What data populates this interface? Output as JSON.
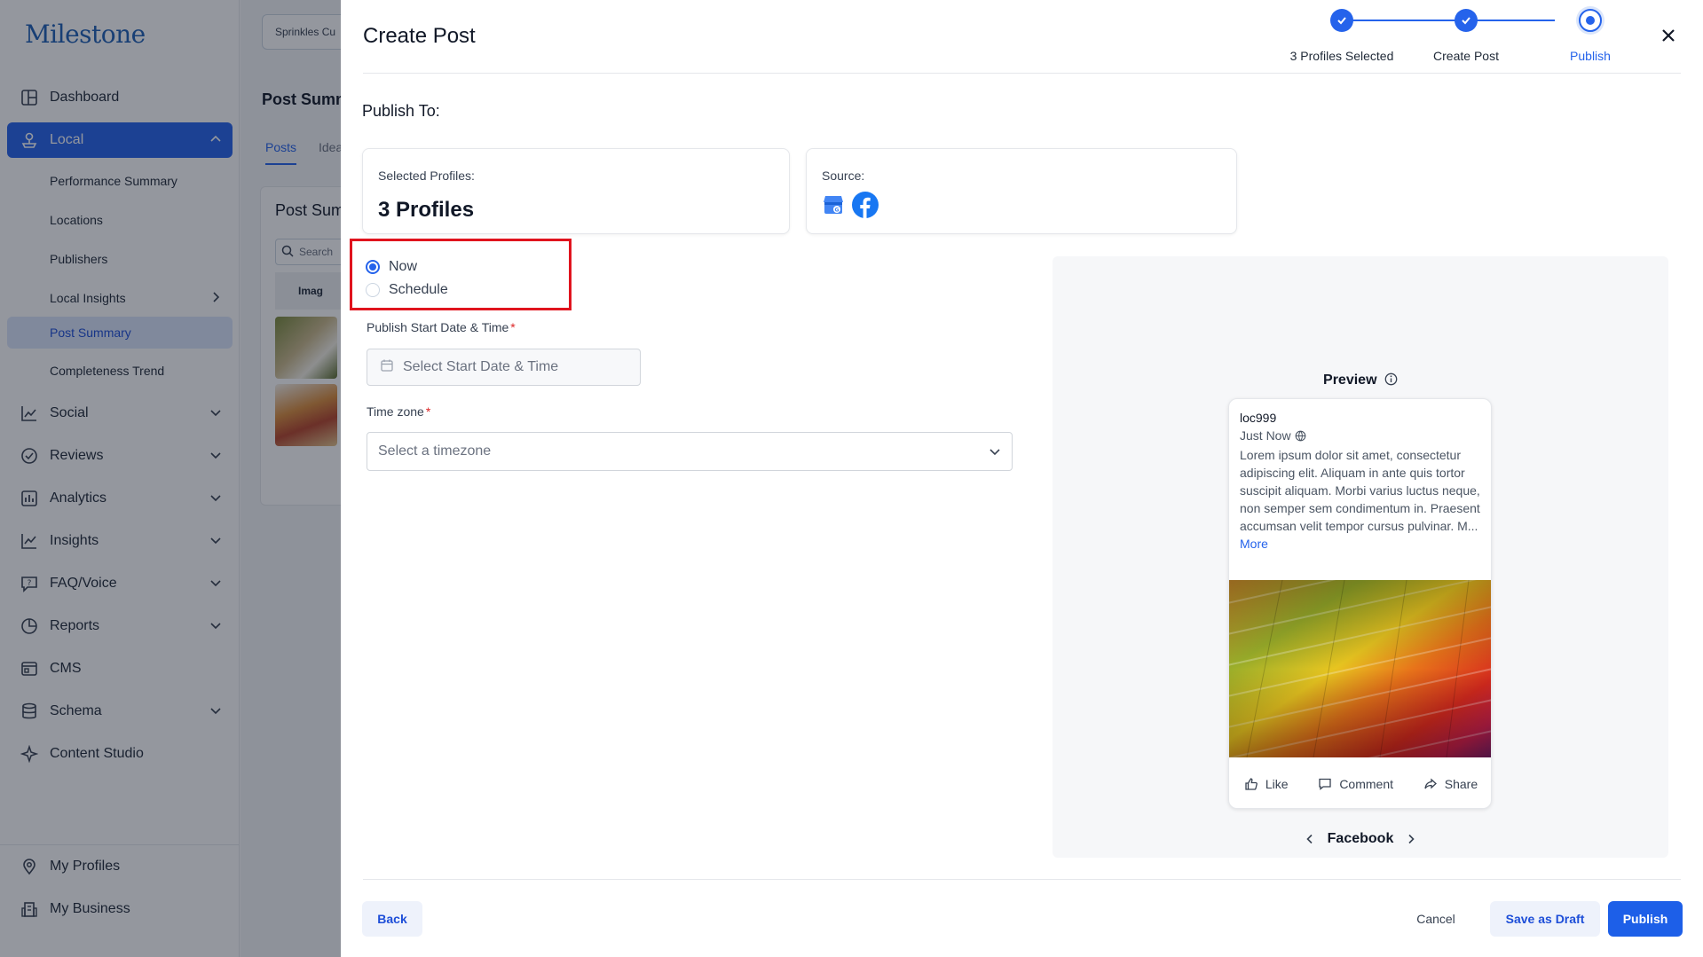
{
  "sidebar": {
    "logo": "Milestone",
    "items": [
      {
        "label": "Dashboard",
        "icon": "dashboard-icon"
      },
      {
        "label": "Local",
        "icon": "local-icon"
      },
      {
        "label": "Social",
        "icon": "social-icon"
      },
      {
        "label": "Reviews",
        "icon": "reviews-icon"
      },
      {
        "label": "Analytics",
        "icon": "analytics-icon"
      },
      {
        "label": "Insights",
        "icon": "insights-icon"
      },
      {
        "label": "FAQ/Voice",
        "icon": "faq-icon"
      },
      {
        "label": "Reports",
        "icon": "reports-icon"
      },
      {
        "label": "CMS",
        "icon": "cms-icon"
      },
      {
        "label": "Schema",
        "icon": "schema-icon"
      },
      {
        "label": "Content Studio",
        "icon": "content-studio-icon"
      }
    ],
    "local_subitems": [
      "Performance Summary",
      "Locations",
      "Publishers",
      "Local Insights",
      "Post Summary",
      "Completeness Trend"
    ],
    "bottom_items": [
      {
        "label": "My Profiles",
        "icon": "location-pin-icon"
      },
      {
        "label": "My Business",
        "icon": "business-icon"
      }
    ]
  },
  "background": {
    "brand_selector": "Sprinkles Cu",
    "page_title": "Post Summ",
    "tabs": [
      "Posts",
      "Idea"
    ],
    "card_title": "Post Sum",
    "search_placeholder": "Search",
    "table_header": "Imag"
  },
  "modal": {
    "title": "Create Post",
    "steps": [
      {
        "label": "3 Profiles Selected",
        "state": "done"
      },
      {
        "label": "Create Post",
        "state": "done"
      },
      {
        "label": "Publish",
        "state": "current"
      }
    ],
    "publish_to_label": "Publish To:",
    "selected_profiles": {
      "label": "Selected Profiles:",
      "value": "3 Profiles"
    },
    "source": {
      "label": "Source:",
      "icons": [
        "google-business-icon",
        "facebook-icon"
      ]
    },
    "timing": {
      "options": [
        "Now",
        "Schedule"
      ],
      "selected": "Now"
    },
    "start_date": {
      "label": "Publish Start Date & Time",
      "required": "*",
      "placeholder": "Select Start Date & Time"
    },
    "timezone": {
      "label": "Time zone",
      "required": "*",
      "placeholder": "Select a timezone"
    },
    "preview": {
      "title": "Preview",
      "profile_name": "loc999",
      "time": "Just Now",
      "body": "Lorem ipsum dolor sit amet, consectetur adipiscing elit. Aliquam in ante quis tortor suscipit aliquam. Morbi varius luctus neque, non semper sem condimentum in. Praesent accumsan velit tempor cursus pulvinar. M...",
      "more": "More",
      "actions": [
        "Like",
        "Comment",
        "Share"
      ],
      "platform": "Facebook"
    },
    "buttons": {
      "back": "Back",
      "cancel": "Cancel",
      "draft": "Save as Draft",
      "publish": "Publish"
    }
  },
  "colors": {
    "primary": "#2563eb",
    "highlight": "#e0141e",
    "facebook": "#1877f2"
  }
}
